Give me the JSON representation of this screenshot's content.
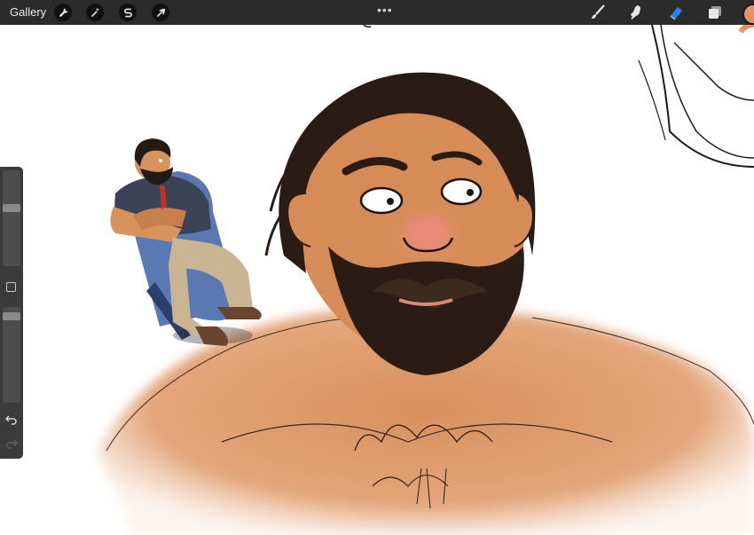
{
  "toolbar": {
    "gallery_label": "Gallery",
    "more_label": "•••",
    "left_tools": [
      {
        "name": "actions",
        "icon": "wrench-icon"
      },
      {
        "name": "adjustments",
        "icon": "magic-wand-icon"
      },
      {
        "name": "selection",
        "icon": "selection-s-icon"
      },
      {
        "name": "transform",
        "icon": "arrow-cursor-icon"
      }
    ],
    "right_tools": [
      {
        "name": "brush",
        "icon": "brush-icon",
        "active": false
      },
      {
        "name": "smudge",
        "icon": "smudge-icon",
        "active": false
      },
      {
        "name": "eraser",
        "icon": "eraser-icon",
        "active": true
      },
      {
        "name": "layers",
        "icon": "layers-icon",
        "active": false
      }
    ],
    "current_color": "#e39462",
    "active_tool_color": "#2f7ff0"
  },
  "sidebar": {
    "brush_size_level": 0.31,
    "brush_opacity_level": 0.02
  },
  "canvas": {
    "background": "#ffffff",
    "skin_color": "#d98f5c",
    "beard_color": "#2a1c15"
  }
}
